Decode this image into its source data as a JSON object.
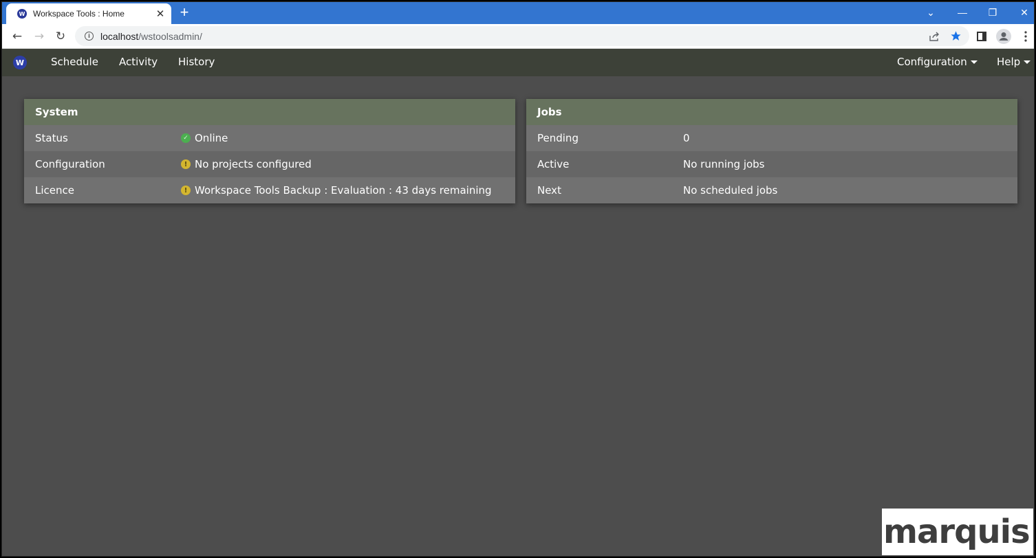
{
  "browser": {
    "tab": {
      "title": "Workspace Tools : Home",
      "favicon_letter": "W"
    },
    "new_tab_label": "+",
    "address": {
      "host": "localhost",
      "path": "/wstoolsadmin/"
    },
    "window_controls": {
      "tab_search": "⌄",
      "minimize": "—",
      "restore": "❐",
      "close": "✕"
    }
  },
  "app": {
    "logo_letter": "W",
    "nav": [
      {
        "label": "Schedule"
      },
      {
        "label": "Activity"
      },
      {
        "label": "History"
      }
    ],
    "nav_right": [
      {
        "label": "Configuration"
      },
      {
        "label": "Help"
      }
    ]
  },
  "system_panel": {
    "title": "System",
    "rows": [
      {
        "label": "Status",
        "value": "Online",
        "icon": "check-circle-icon",
        "icon_glyph": "✓",
        "status": "ok"
      },
      {
        "label": "Configuration",
        "value": "No projects configured",
        "icon": "warning-icon",
        "icon_glyph": "!",
        "status": "warn"
      },
      {
        "label": "Licence",
        "value": "Workspace Tools Backup : Evaluation : 43 days remaining",
        "icon": "warning-icon",
        "icon_glyph": "!",
        "status": "warn"
      }
    ]
  },
  "jobs_panel": {
    "title": "Jobs",
    "rows": [
      {
        "label": "Pending",
        "value": "0"
      },
      {
        "label": "Active",
        "value": "No running jobs"
      },
      {
        "label": "Next",
        "value": "No scheduled jobs"
      }
    ]
  },
  "brand": {
    "text": "marquis"
  },
  "colors": {
    "panel_header": "#67735e",
    "navbar": "#3d4138",
    "background": "#4d4d4d",
    "ok": "#4caf50",
    "warn": "#d4b62f",
    "browser_accent": "#3375d0"
  }
}
